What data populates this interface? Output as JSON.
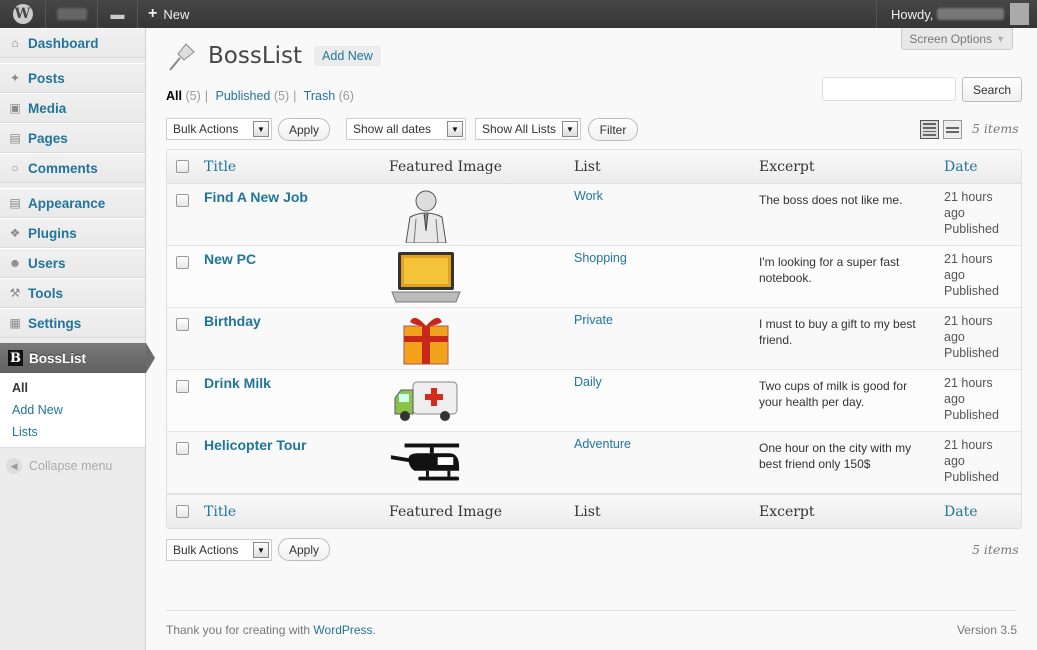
{
  "adminbar": {
    "new_label": "New",
    "howdy_label": "Howdy,"
  },
  "menu": {
    "items": [
      {
        "label": "Dashboard",
        "icon": "home-icon"
      },
      {
        "label": "Posts",
        "icon": "pin-icon"
      },
      {
        "label": "Media",
        "icon": "media-icon"
      },
      {
        "label": "Pages",
        "icon": "pages-icon"
      },
      {
        "label": "Comments",
        "icon": "comment-icon"
      },
      {
        "label": "Appearance",
        "icon": "appearance-icon"
      },
      {
        "label": "Plugins",
        "icon": "plugin-icon"
      },
      {
        "label": "Users",
        "icon": "users-icon"
      },
      {
        "label": "Tools",
        "icon": "tools-icon"
      },
      {
        "label": "Settings",
        "icon": "settings-icon"
      },
      {
        "label": "BossList",
        "icon": "bosslist-icon"
      }
    ],
    "submenu": [
      "All",
      "Add New",
      "Lists"
    ],
    "collapse_label": "Collapse menu"
  },
  "page": {
    "title": "BossList",
    "add_new": "Add New",
    "screen_options": "Screen Options",
    "views": [
      {
        "label": "All",
        "count": "(5)"
      },
      {
        "label": "Published",
        "count": "(5)"
      },
      {
        "label": "Trash",
        "count": "(6)"
      }
    ],
    "search_button": "Search",
    "search_placeholder": "",
    "bulk_actions": "Bulk Actions",
    "apply": "Apply",
    "dates_filter": "Show all dates",
    "lists_filter": "Show All Lists",
    "filter_button": "Filter",
    "items_count": "5 items"
  },
  "table": {
    "columns": [
      "Title",
      "Featured Image",
      "List",
      "Excerpt",
      "Date"
    ],
    "rows": [
      {
        "title": "Find A New Job",
        "image": "businessman-image",
        "list": "Work",
        "excerpt": "The boss does not like me.",
        "date1": "21 hours",
        "date2": "ago",
        "status": "Published"
      },
      {
        "title": "New PC",
        "image": "laptop-image",
        "list": "Shopping",
        "excerpt": "I'm looking for a super fast notebook.",
        "date1": "21 hours",
        "date2": "ago",
        "status": "Published"
      },
      {
        "title": "Birthday",
        "image": "gift-image",
        "list": "Private",
        "excerpt": "I must to buy a gift to my best friend.",
        "date1": "21 hours",
        "date2": "ago",
        "status": "Published"
      },
      {
        "title": "Drink Milk",
        "image": "ambulance-image",
        "list": "Daily",
        "excerpt": "Two cups of milk is good for your health per day.",
        "date1": "21 hours",
        "date2": "ago",
        "status": "Published"
      },
      {
        "title": "Helicopter Tour",
        "image": "helicopter-image",
        "list": "Adventure",
        "excerpt": "One hour on the city with my best friend only 150$",
        "date1": "21 hours",
        "date2": "ago",
        "status": "Published"
      }
    ]
  },
  "footer": {
    "thanks_prefix": "Thank you for creating with",
    "wordpress_link": "WordPress",
    "thanks_suffix": ".",
    "version": "Version 3.5"
  }
}
